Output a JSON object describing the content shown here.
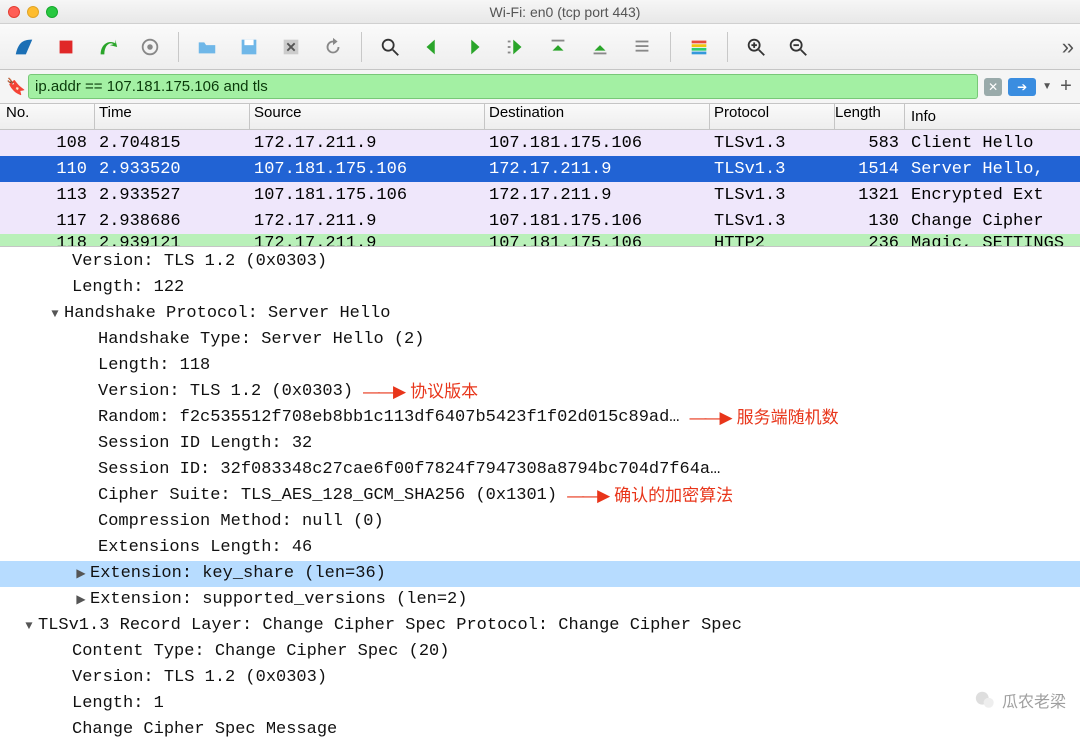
{
  "window": {
    "title": "Wi-Fi: en0 (tcp port 443)"
  },
  "filter": {
    "value": "ip.addr == 107.181.175.106 and tls"
  },
  "columns": {
    "no": "No.",
    "time": "Time",
    "source": "Source",
    "destination": "Destination",
    "protocol": "Protocol",
    "length": "Length",
    "info": "Info"
  },
  "packets": [
    {
      "no": "108",
      "time": "2.704815",
      "src": "172.17.211.9",
      "dst": "107.181.175.106",
      "proto": "TLSv1.3",
      "len": "583",
      "info": "Client Hello",
      "cls": "row-purple"
    },
    {
      "no": "110",
      "time": "2.933520",
      "src": "107.181.175.106",
      "dst": "172.17.211.9",
      "proto": "TLSv1.3",
      "len": "1514",
      "info": "Server Hello,",
      "cls": "row-selected"
    },
    {
      "no": "113",
      "time": "2.933527",
      "src": "107.181.175.106",
      "dst": "172.17.211.9",
      "proto": "TLSv1.3",
      "len": "1321",
      "info": "Encrypted Ext",
      "cls": "row-purple"
    },
    {
      "no": "117",
      "time": "2.938686",
      "src": "172.17.211.9",
      "dst": "107.181.175.106",
      "proto": "TLSv1.3",
      "len": "130",
      "info": "Change Cipher",
      "cls": "row-purple"
    },
    {
      "no": "118",
      "time": "2.939121",
      "src": "172.17.211.9",
      "dst": "107.181.175.106",
      "proto": "HTTP2",
      "len": "236",
      "info": "Magic, SETTINGS",
      "cls": "row-green-partial"
    }
  ],
  "tree": {
    "l1": "Version: TLS 1.2 (0x0303)",
    "l2": "Length: 122",
    "l3": "Handshake Protocol: Server Hello",
    "l4": "Handshake Type: Server Hello (2)",
    "l5": "Length: 118",
    "l6": "Version: TLS 1.2 (0x0303)",
    "l7": "Random: f2c535512f708eb8bb1c113df6407b5423f1f02d015c89ad…",
    "l8": "Session ID Length: 32",
    "l9": "Session ID: 32f083348c27cae6f00f7824f7947308a8794bc704d7f64a…",
    "l10": "Cipher Suite: TLS_AES_128_GCM_SHA256 (0x1301)",
    "l11": "Compression Method: null (0)",
    "l12": "Extensions Length: 46",
    "l13": "Extension: key_share (len=36)",
    "l14": "Extension: supported_versions (len=2)",
    "l15": "TLSv1.3 Record Layer: Change Cipher Spec Protocol: Change Cipher Spec",
    "l16": "Content Type: Change Cipher Spec (20)",
    "l17": "Version: TLS 1.2 (0x0303)",
    "l18": "Length: 1",
    "l19": "Change Cipher Spec Message"
  },
  "annotations": {
    "version": "协议版本",
    "random": "服务端随机数",
    "cipher": "确认的加密算法"
  },
  "watermark": "瓜农老梁"
}
